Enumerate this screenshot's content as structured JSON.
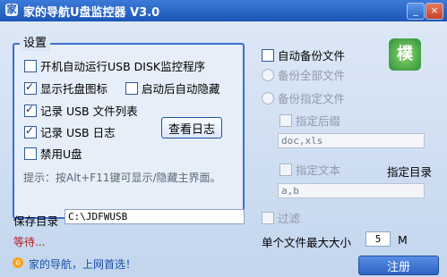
{
  "window": {
    "title": "家的导航U盘监控器 V3.0",
    "app_icon": "app-icon",
    "controls": {
      "minimize": "_",
      "close": "×"
    }
  },
  "settings_group": {
    "legend": "设置",
    "options": [
      {
        "label": "开机自动运行USB DISK监控程序",
        "checked": false
      },
      {
        "label": "显示托盘图标",
        "checked": true
      },
      {
        "label": "启动后自动隐藏",
        "checked": false
      },
      {
        "label": "记录 USB 文件列表",
        "checked": true
      },
      {
        "label": "记录 USB 日志",
        "checked": true
      },
      {
        "label": "禁用U盘",
        "checked": false
      }
    ],
    "view_log_button": "查看日志",
    "hint": "提示：按Alt+F11键可显示/隐藏主界面。"
  },
  "backup": {
    "auto_backup_label": "自动备份文件",
    "backup_all_label": "备份全部文件",
    "backup_specific_label": "备份指定文件",
    "ext_label": "指定后缀",
    "ext_value": "doc,xls",
    "text_label": "指定文本",
    "text_value": "a,b",
    "target_dir_label": "指定目录",
    "filter_label": "过滤",
    "max_size_label": "单个文件最大大小",
    "max_size_value": "5",
    "max_size_unit": "M",
    "logo_text": "樸"
  },
  "save_dir": {
    "label": "保存目录",
    "value": "C:\\JDFWUSB"
  },
  "status": {
    "text": "等待..."
  },
  "footer": {
    "link_text": "家的导航，上网首选！",
    "register_button": "注册"
  },
  "colors": {
    "title_bar": "#1c56b8",
    "group_border": "#3c6fcf",
    "status_red": "#b31f1f",
    "link_blue": "#184fa6"
  }
}
